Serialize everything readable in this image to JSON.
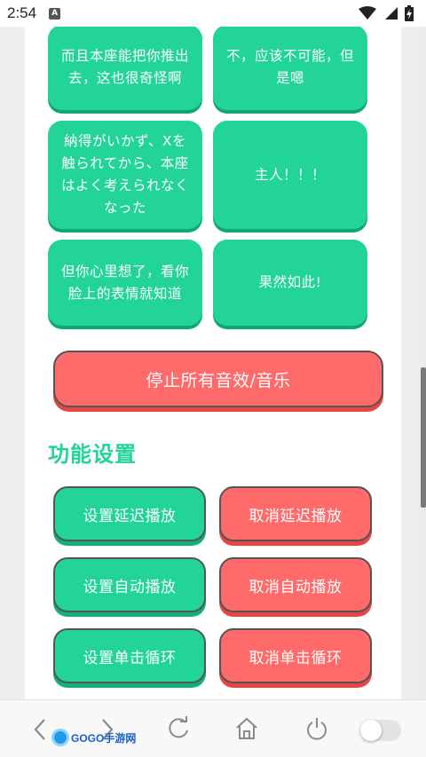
{
  "status_bar": {
    "time": "2:54",
    "notification_badge": "A"
  },
  "sound_tiles": [
    "而且本座能把你推出去，这也很奇怪啊",
    "不，应该不可能，但是嗯",
    "納得がいかず、Xを触られてから、本座はよく考えられなくなった",
    "主人！！！",
    "但你心里想了，看你脸上的表情就知道",
    "果然如此!"
  ],
  "stop_button": {
    "label": "停止所有音效/音乐"
  },
  "function_settings": {
    "title": "功能设置",
    "buttons": [
      {
        "label": "设置延迟播放",
        "color": "#22d39a"
      },
      {
        "label": "取消延迟播放",
        "color": "#ff6a6a"
      },
      {
        "label": "设置自动播放",
        "color": "#22d39a"
      },
      {
        "label": "取消自动播放",
        "color": "#ff6a6a"
      },
      {
        "label": "设置单击循环",
        "color": "#22d39a"
      },
      {
        "label": "取消单击循环",
        "color": "#ff6a6a"
      }
    ]
  },
  "watermark": {
    "brand": "GOGO手游网"
  },
  "colors": {
    "accent_green": "#22d39a",
    "accent_red": "#ff6a6a"
  }
}
